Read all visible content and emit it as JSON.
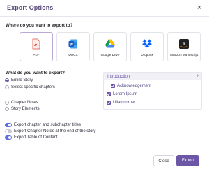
{
  "dialog": {
    "title": "Export Options",
    "close_glyph": "×"
  },
  "destination": {
    "question": "Where do you want to export to?",
    "options": [
      {
        "label": "PDF",
        "icon": "pdf-icon",
        "selected": true
      },
      {
        "label": "DOCX",
        "icon": "docx-icon",
        "selected": false
      },
      {
        "label": "Google Drive",
        "icon": "google-drive-icon",
        "selected": false
      },
      {
        "label": "Dropbox",
        "icon": "dropbox-icon",
        "selected": false
      },
      {
        "label": "Amazon Manuscript",
        "icon": "amazon-icon",
        "selected": false
      }
    ]
  },
  "content": {
    "question": "What do you want to export?",
    "scope_options": [
      "Entire Story",
      "Select specific chapters"
    ],
    "scope_selected": "Entire Story",
    "extra_options": [
      "Chapter Notes",
      "Story Elements"
    ]
  },
  "chapters": {
    "header": "Introduction",
    "items": [
      {
        "label": "Acknowledgement",
        "checked": true
      },
      {
        "label": "Lorem Ipsum",
        "checked": true
      },
      {
        "label": "Ullamcorper",
        "checked": true
      }
    ]
  },
  "toggles": [
    {
      "label": "Export chapter and subchapter titles",
      "on": true
    },
    {
      "label": "Export Chapter Notes at the end of the story",
      "on": false
    },
    {
      "label": "Export Table of Content",
      "on": true
    }
  ],
  "footer": {
    "close_label": "Close",
    "export_label": "Export"
  },
  "colors": {
    "accent": "#6c56a6",
    "toggle_on": "#5b6fe0",
    "toggle_off": "#c7c7d2"
  }
}
